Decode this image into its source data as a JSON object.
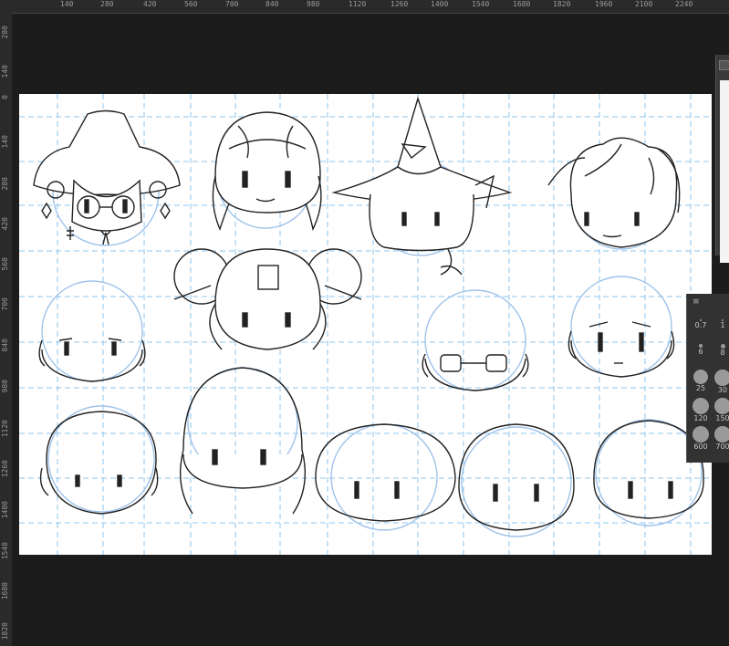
{
  "ruler_top": {
    "labels": [
      "140",
      "280",
      "420",
      "560",
      "700",
      "840",
      "980",
      "1120",
      "1260",
      "1400",
      "1540",
      "1680",
      "1820",
      "1960",
      "2100",
      "2240"
    ]
  },
  "ruler_left": {
    "labels": [
      "280",
      "140",
      "0",
      "140",
      "280",
      "420",
      "560",
      "700",
      "840",
      "980",
      "1120",
      "1260",
      "1400",
      "1540",
      "1680",
      "1820"
    ]
  },
  "brush_panel": {
    "menu_label": "≡",
    "sizes": [
      {
        "label": "0.7"
      },
      {
        "label": "1"
      },
      {
        "label": "6"
      },
      {
        "label": "8"
      },
      {
        "label": "25"
      },
      {
        "label": "30"
      },
      {
        "label": "120"
      },
      {
        "label": "150"
      },
      {
        "label": "600"
      },
      {
        "label": "700"
      }
    ]
  },
  "colors": {
    "line_art": "#222222",
    "sketch_blue": "#9fc3ea",
    "grid_blue": "#8ec5ef"
  }
}
